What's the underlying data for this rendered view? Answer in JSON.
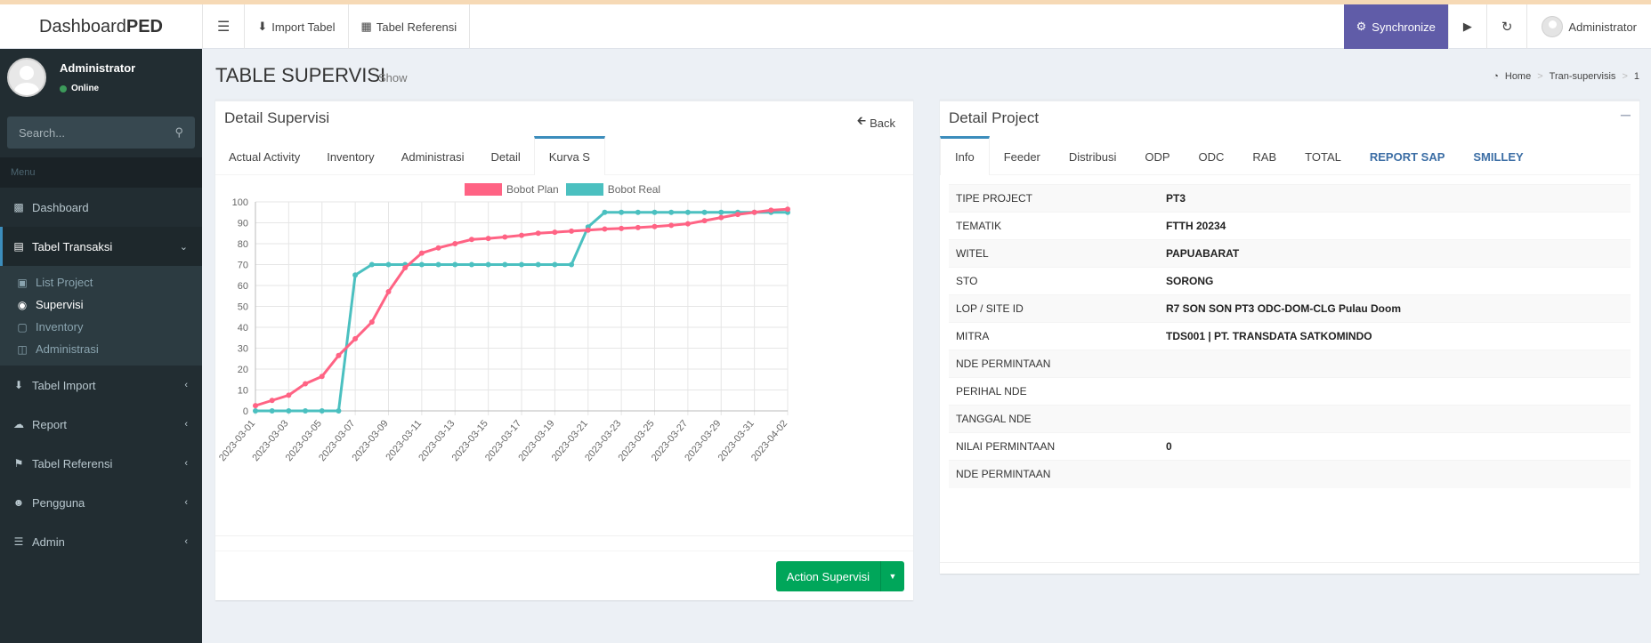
{
  "app": {
    "logo_plain": "Dashboard",
    "logo_bold": "PED"
  },
  "topnav": {
    "menu_icon": "bars-icon",
    "import": "Import Tabel",
    "referensi": "Tabel Referensi",
    "sync": "Synchronize",
    "user": "Administrator"
  },
  "sidebar": {
    "user_name": "Administrator",
    "status": "Online",
    "search_placeholder": "Search...",
    "menu_header": "Menu",
    "items": [
      {
        "label": "Dashboard"
      },
      {
        "label": "Tabel Transaksi"
      },
      {
        "label": "Tabel Import"
      },
      {
        "label": "Report"
      },
      {
        "label": "Tabel Referensi"
      },
      {
        "label": "Pengguna"
      },
      {
        "label": "Admin"
      }
    ],
    "sub": [
      {
        "label": "List Project"
      },
      {
        "label": "Supervisi"
      },
      {
        "label": "Inventory"
      },
      {
        "label": "Administrasi"
      }
    ]
  },
  "page": {
    "title": "TABLE SUPERVISI",
    "subtitle": "Show",
    "breadcrumb": [
      "Home",
      "Tran-supervisis",
      "1"
    ]
  },
  "left_box": {
    "title": "Detail Supervisi",
    "back": "Back",
    "tabs": [
      "Actual Activity",
      "Inventory",
      "Administrasi",
      "Detail",
      "Kurva S"
    ],
    "action": "Action Supervisi"
  },
  "right_box": {
    "title": "Detail Project",
    "tabs": [
      "Info",
      "Feeder",
      "Distribusi",
      "ODP",
      "ODC",
      "RAB",
      "TOTAL",
      "REPORT SAP",
      "SMILLEY"
    ],
    "rows": [
      {
        "k": "TIPE PROJECT",
        "v": "PT3"
      },
      {
        "k": "TEMATIK",
        "v": "FTTH 20234"
      },
      {
        "k": "WITEL",
        "v": "PAPUABARAT"
      },
      {
        "k": "STO",
        "v": "SORONG"
      },
      {
        "k": "LOP / SITE ID",
        "v": "R7 SON SON PT3 ODC-DOM-CLG Pulau Doom"
      },
      {
        "k": "MITRA",
        "v": "TDS001 | PT. TRANSDATA SATKOMINDO"
      },
      {
        "k": "NDE PERMINTAAN",
        "v": ""
      },
      {
        "k": "PERIHAL NDE",
        "v": ""
      },
      {
        "k": "TANGGAL NDE",
        "v": ""
      },
      {
        "k": "NILAI PERMINTAAN",
        "v": "0"
      },
      {
        "k": "NDE PERMINTAAN",
        "v": ""
      }
    ]
  },
  "chart_data": {
    "type": "line",
    "x": [
      "2023-03-01",
      "2023-03-02",
      "2023-03-03",
      "2023-03-04",
      "2023-03-05",
      "2023-03-06",
      "2023-03-07",
      "2023-03-08",
      "2023-03-09",
      "2023-03-10",
      "2023-03-11",
      "2023-03-12",
      "2023-03-13",
      "2023-03-14",
      "2023-03-15",
      "2023-03-16",
      "2023-03-17",
      "2023-03-18",
      "2023-03-19",
      "2023-03-20",
      "2023-03-21",
      "2023-03-22",
      "2023-03-23",
      "2023-03-24",
      "2023-03-25",
      "2023-03-26",
      "2023-03-27",
      "2023-03-28",
      "2023-03-29",
      "2023-03-30",
      "2023-03-31",
      "2023-04-01",
      "2023-04-02"
    ],
    "x_tick_labels": [
      "2023-03-01",
      "2023-03-03",
      "2023-03-05",
      "2023-03-07",
      "2023-03-09",
      "2023-03-11",
      "2023-03-13",
      "2023-03-15",
      "2023-03-17",
      "2023-03-19",
      "2023-03-21",
      "2023-03-23",
      "2023-03-25",
      "2023-03-27",
      "2023-03-29",
      "2023-03-31",
      "2023-04-02"
    ],
    "series": [
      {
        "name": "Bobot Plan",
        "color": "#ff6384",
        "values": [
          2.5,
          5,
          7.5,
          13,
          16.5,
          26.5,
          34.5,
          42.5,
          57,
          68.5,
          75.5,
          78,
          80,
          82,
          82.5,
          83.2,
          84,
          85,
          85.5,
          86,
          86.5,
          87,
          87.3,
          87.7,
          88.2,
          88.8,
          89.5,
          91,
          92.5,
          94,
          95,
          96,
          96.5
        ]
      },
      {
        "name": "Bobot Real",
        "color": "#4bc0c0",
        "values": [
          0,
          0,
          0,
          0,
          0,
          0,
          65,
          70,
          70,
          70,
          70,
          70,
          70,
          70,
          70,
          70,
          70,
          70,
          70,
          70,
          88,
          95,
          95,
          95,
          95,
          95,
          95,
          95,
          95,
          95,
          95,
          95,
          95
        ]
      }
    ],
    "ylim": [
      0,
      100
    ],
    "yticks": [
      0,
      10,
      20,
      30,
      40,
      50,
      60,
      70,
      80,
      90,
      100
    ],
    "grid": true,
    "legend": "top-center"
  }
}
